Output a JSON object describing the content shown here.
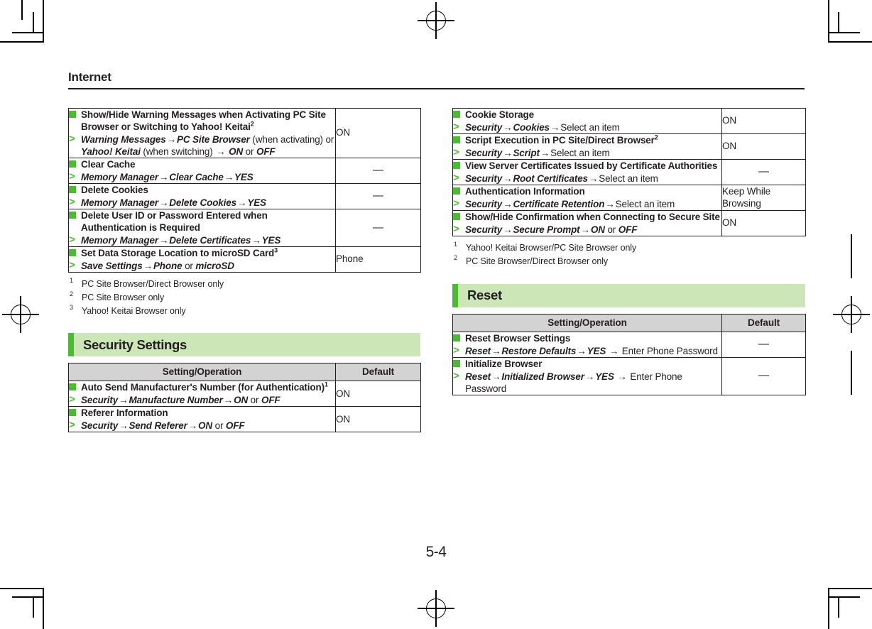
{
  "page": {
    "running_head": "Internet",
    "folio": "5-4"
  },
  "colors": {
    "accent_green": "#4cbb33",
    "section_bg": "#cce6b8",
    "header_row_bg": "#d3d3d3",
    "text": "#231f20"
  },
  "table_headers": {
    "setting_operation": "Setting/Operation",
    "default": "Default"
  },
  "left_column": {
    "continued_table": {
      "rows": [
        {
          "title": "Show/Hide Warning Messages when Activating PC Site Browser or Switching to Yahoo! Keitai",
          "title_sup": "2",
          "operation": [
            {
              "t": "Warning Messages",
              "s": "i"
            },
            {
              "t": "→",
              "s": "arw"
            },
            {
              "t": "PC Site Browser",
              "s": "i"
            },
            {
              "t": " (when activating) or ",
              "s": "plain"
            },
            {
              "t": "Yahoo! Keitai",
              "s": "i"
            },
            {
              "t": " (when switching) ",
              "s": "plain"
            },
            {
              "t": "→",
              "s": "arw"
            },
            {
              "t": " ",
              "s": "plain"
            },
            {
              "t": "ON",
              "s": "i"
            },
            {
              "t": " or ",
              "s": "plain"
            },
            {
              "t": "OFF",
              "s": "i"
            }
          ],
          "default": "ON"
        },
        {
          "title": "Clear Cache",
          "title_sup": "",
          "operation": [
            {
              "t": "Memory Manager",
              "s": "i"
            },
            {
              "t": "→",
              "s": "arw"
            },
            {
              "t": "Clear Cache",
              "s": "i"
            },
            {
              "t": "→",
              "s": "arw"
            },
            {
              "t": "YES",
              "s": "i"
            }
          ],
          "default": "—"
        },
        {
          "title": "Delete Cookies",
          "title_sup": "",
          "operation": [
            {
              "t": "Memory Manager",
              "s": "i"
            },
            {
              "t": "→",
              "s": "arw"
            },
            {
              "t": "Delete Cookies",
              "s": "i"
            },
            {
              "t": "→",
              "s": "arw"
            },
            {
              "t": "YES",
              "s": "i"
            }
          ],
          "default": "—"
        },
        {
          "title": "Delete User ID or Password Entered when Authentication is Required",
          "title_sup": "",
          "operation": [
            {
              "t": "Memory Manager",
              "s": "i"
            },
            {
              "t": "→",
              "s": "arw"
            },
            {
              "t": "Delete Certificates",
              "s": "i"
            },
            {
              "t": "→",
              "s": "arw"
            },
            {
              "t": "YES",
              "s": "i"
            }
          ],
          "default": "—"
        },
        {
          "title": "Set Data Storage Location to microSD Card",
          "title_sup": "3",
          "operation": [
            {
              "t": "Save Settings",
              "s": "i"
            },
            {
              "t": "→",
              "s": "arw"
            },
            {
              "t": "Phone",
              "s": "i"
            },
            {
              "t": " or ",
              "s": "plain"
            },
            {
              "t": "microSD",
              "s": "i"
            }
          ],
          "default": "Phone"
        }
      ]
    },
    "footnotes": [
      {
        "num": "1",
        "text": "PC Site Browser/Direct Browser only"
      },
      {
        "num": "2",
        "text": "PC Site Browser only"
      },
      {
        "num": "3",
        "text": "Yahoo! Keitai Browser only"
      }
    ],
    "section": {
      "title": "Security Settings",
      "rows": [
        {
          "title": "Auto Send Manufacturer's Number (for Authentication)",
          "title_sup": "1",
          "operation": [
            {
              "t": "Security",
              "s": "i"
            },
            {
              "t": "→",
              "s": "arw"
            },
            {
              "t": "Manufacture Number",
              "s": "i"
            },
            {
              "t": "→",
              "s": "arw"
            },
            {
              "t": "ON",
              "s": "i"
            },
            {
              "t": " or ",
              "s": "plain"
            },
            {
              "t": "OFF",
              "s": "i"
            }
          ],
          "default": "ON"
        },
        {
          "title": "Referer Information",
          "title_sup": "",
          "operation": [
            {
              "t": "Security",
              "s": "i"
            },
            {
              "t": "→",
              "s": "arw"
            },
            {
              "t": "Send Referer",
              "s": "i"
            },
            {
              "t": "→",
              "s": "arw"
            },
            {
              "t": "ON",
              "s": "i"
            },
            {
              "t": " or ",
              "s": "plain"
            },
            {
              "t": "OFF",
              "s": "i"
            }
          ],
          "default": "ON"
        }
      ]
    }
  },
  "right_column": {
    "continued_table": {
      "rows": [
        {
          "title": "Cookie Storage",
          "title_sup": "",
          "operation": [
            {
              "t": "Security",
              "s": "i"
            },
            {
              "t": "→",
              "s": "arw"
            },
            {
              "t": "Cookies",
              "s": "i"
            },
            {
              "t": "→",
              "s": "arw"
            },
            {
              "t": "Select an item",
              "s": "plain"
            }
          ],
          "default": "ON"
        },
        {
          "title": "Script Execution in PC Site/Direct Browser",
          "title_sup": "2",
          "operation": [
            {
              "t": "Security",
              "s": "i"
            },
            {
              "t": "→",
              "s": "arw"
            },
            {
              "t": "Script",
              "s": "i"
            },
            {
              "t": "→",
              "s": "arw"
            },
            {
              "t": "Select an item",
              "s": "plain"
            }
          ],
          "default": "ON"
        },
        {
          "title": "View Server Certificates Issued by Certificate Authorities",
          "title_sup": "",
          "operation": [
            {
              "t": "Security",
              "s": "i"
            },
            {
              "t": "→",
              "s": "arw"
            },
            {
              "t": "Root Certificates",
              "s": "i"
            },
            {
              "t": "→",
              "s": "arw"
            },
            {
              "t": "Select an item",
              "s": "plain"
            }
          ],
          "default": "—"
        },
        {
          "title": "Authentication Information",
          "title_sup": "",
          "operation": [
            {
              "t": "Security",
              "s": "i"
            },
            {
              "t": "→",
              "s": "arw"
            },
            {
              "t": "Certificate Retention",
              "s": "i"
            },
            {
              "t": "→",
              "s": "arw"
            },
            {
              "t": "Select an item",
              "s": "plain"
            }
          ],
          "default": "Keep While Browsing"
        },
        {
          "title": "Show/Hide Confirmation when Connecting to Secure Site",
          "title_sup": "",
          "operation": [
            {
              "t": "Security",
              "s": "i"
            },
            {
              "t": "→",
              "s": "arw"
            },
            {
              "t": "Secure Prompt",
              "s": "i"
            },
            {
              "t": "→",
              "s": "arw"
            },
            {
              "t": "ON",
              "s": "i"
            },
            {
              "t": " or ",
              "s": "plain"
            },
            {
              "t": "OFF",
              "s": "i"
            }
          ],
          "default": "ON"
        }
      ]
    },
    "footnotes": [
      {
        "num": "1",
        "text": "Yahoo! Keitai Browser/PC Site Browser only"
      },
      {
        "num": "2",
        "text": "PC Site Browser/Direct Browser only"
      }
    ],
    "section": {
      "title": "Reset",
      "rows": [
        {
          "title": "Reset Browser Settings",
          "title_sup": "",
          "operation": [
            {
              "t": "Reset",
              "s": "i"
            },
            {
              "t": "→",
              "s": "arw"
            },
            {
              "t": "Restore Defaults",
              "s": "i"
            },
            {
              "t": "→",
              "s": "arw"
            },
            {
              "t": "YES",
              "s": "i"
            },
            {
              "t": " ",
              "s": "plain"
            },
            {
              "t": "→",
              "s": "arw"
            },
            {
              "t": " Enter Phone Password",
              "s": "plain"
            }
          ],
          "default": "—"
        },
        {
          "title": "Initialize Browser",
          "title_sup": "",
          "operation": [
            {
              "t": "Reset",
              "s": "i"
            },
            {
              "t": "→",
              "s": "arw"
            },
            {
              "t": "Initialized Browser",
              "s": "i"
            },
            {
              "t": "→",
              "s": "arw"
            },
            {
              "t": "YES",
              "s": "i"
            },
            {
              "t": " ",
              "s": "plain"
            },
            {
              "t": "→",
              "s": "arw"
            },
            {
              "t": " Enter Phone Password",
              "s": "plain"
            }
          ],
          "default": "—"
        }
      ]
    }
  }
}
